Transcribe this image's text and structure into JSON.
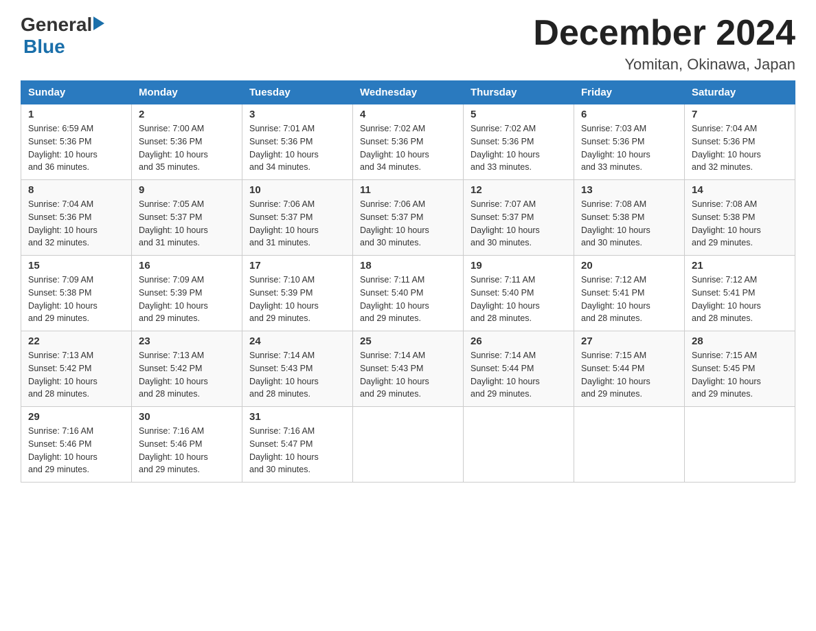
{
  "logo": {
    "general": "General",
    "arrow": "",
    "blue": "Blue"
  },
  "title": "December 2024",
  "subtitle": "Yomitan, Okinawa, Japan",
  "days_of_week": [
    "Sunday",
    "Monday",
    "Tuesday",
    "Wednesday",
    "Thursday",
    "Friday",
    "Saturday"
  ],
  "weeks": [
    [
      {
        "num": "1",
        "info": "Sunrise: 6:59 AM\nSunset: 5:36 PM\nDaylight: 10 hours\nand 36 minutes."
      },
      {
        "num": "2",
        "info": "Sunrise: 7:00 AM\nSunset: 5:36 PM\nDaylight: 10 hours\nand 35 minutes."
      },
      {
        "num": "3",
        "info": "Sunrise: 7:01 AM\nSunset: 5:36 PM\nDaylight: 10 hours\nand 34 minutes."
      },
      {
        "num": "4",
        "info": "Sunrise: 7:02 AM\nSunset: 5:36 PM\nDaylight: 10 hours\nand 34 minutes."
      },
      {
        "num": "5",
        "info": "Sunrise: 7:02 AM\nSunset: 5:36 PM\nDaylight: 10 hours\nand 33 minutes."
      },
      {
        "num": "6",
        "info": "Sunrise: 7:03 AM\nSunset: 5:36 PM\nDaylight: 10 hours\nand 33 minutes."
      },
      {
        "num": "7",
        "info": "Sunrise: 7:04 AM\nSunset: 5:36 PM\nDaylight: 10 hours\nand 32 minutes."
      }
    ],
    [
      {
        "num": "8",
        "info": "Sunrise: 7:04 AM\nSunset: 5:36 PM\nDaylight: 10 hours\nand 32 minutes."
      },
      {
        "num": "9",
        "info": "Sunrise: 7:05 AM\nSunset: 5:37 PM\nDaylight: 10 hours\nand 31 minutes."
      },
      {
        "num": "10",
        "info": "Sunrise: 7:06 AM\nSunset: 5:37 PM\nDaylight: 10 hours\nand 31 minutes."
      },
      {
        "num": "11",
        "info": "Sunrise: 7:06 AM\nSunset: 5:37 PM\nDaylight: 10 hours\nand 30 minutes."
      },
      {
        "num": "12",
        "info": "Sunrise: 7:07 AM\nSunset: 5:37 PM\nDaylight: 10 hours\nand 30 minutes."
      },
      {
        "num": "13",
        "info": "Sunrise: 7:08 AM\nSunset: 5:38 PM\nDaylight: 10 hours\nand 30 minutes."
      },
      {
        "num": "14",
        "info": "Sunrise: 7:08 AM\nSunset: 5:38 PM\nDaylight: 10 hours\nand 29 minutes."
      }
    ],
    [
      {
        "num": "15",
        "info": "Sunrise: 7:09 AM\nSunset: 5:38 PM\nDaylight: 10 hours\nand 29 minutes."
      },
      {
        "num": "16",
        "info": "Sunrise: 7:09 AM\nSunset: 5:39 PM\nDaylight: 10 hours\nand 29 minutes."
      },
      {
        "num": "17",
        "info": "Sunrise: 7:10 AM\nSunset: 5:39 PM\nDaylight: 10 hours\nand 29 minutes."
      },
      {
        "num": "18",
        "info": "Sunrise: 7:11 AM\nSunset: 5:40 PM\nDaylight: 10 hours\nand 29 minutes."
      },
      {
        "num": "19",
        "info": "Sunrise: 7:11 AM\nSunset: 5:40 PM\nDaylight: 10 hours\nand 28 minutes."
      },
      {
        "num": "20",
        "info": "Sunrise: 7:12 AM\nSunset: 5:41 PM\nDaylight: 10 hours\nand 28 minutes."
      },
      {
        "num": "21",
        "info": "Sunrise: 7:12 AM\nSunset: 5:41 PM\nDaylight: 10 hours\nand 28 minutes."
      }
    ],
    [
      {
        "num": "22",
        "info": "Sunrise: 7:13 AM\nSunset: 5:42 PM\nDaylight: 10 hours\nand 28 minutes."
      },
      {
        "num": "23",
        "info": "Sunrise: 7:13 AM\nSunset: 5:42 PM\nDaylight: 10 hours\nand 28 minutes."
      },
      {
        "num": "24",
        "info": "Sunrise: 7:14 AM\nSunset: 5:43 PM\nDaylight: 10 hours\nand 28 minutes."
      },
      {
        "num": "25",
        "info": "Sunrise: 7:14 AM\nSunset: 5:43 PM\nDaylight: 10 hours\nand 29 minutes."
      },
      {
        "num": "26",
        "info": "Sunrise: 7:14 AM\nSunset: 5:44 PM\nDaylight: 10 hours\nand 29 minutes."
      },
      {
        "num": "27",
        "info": "Sunrise: 7:15 AM\nSunset: 5:44 PM\nDaylight: 10 hours\nand 29 minutes."
      },
      {
        "num": "28",
        "info": "Sunrise: 7:15 AM\nSunset: 5:45 PM\nDaylight: 10 hours\nand 29 minutes."
      }
    ],
    [
      {
        "num": "29",
        "info": "Sunrise: 7:16 AM\nSunset: 5:46 PM\nDaylight: 10 hours\nand 29 minutes."
      },
      {
        "num": "30",
        "info": "Sunrise: 7:16 AM\nSunset: 5:46 PM\nDaylight: 10 hours\nand 29 minutes."
      },
      {
        "num": "31",
        "info": "Sunrise: 7:16 AM\nSunset: 5:47 PM\nDaylight: 10 hours\nand 30 minutes."
      },
      {
        "num": "",
        "info": ""
      },
      {
        "num": "",
        "info": ""
      },
      {
        "num": "",
        "info": ""
      },
      {
        "num": "",
        "info": ""
      }
    ]
  ]
}
